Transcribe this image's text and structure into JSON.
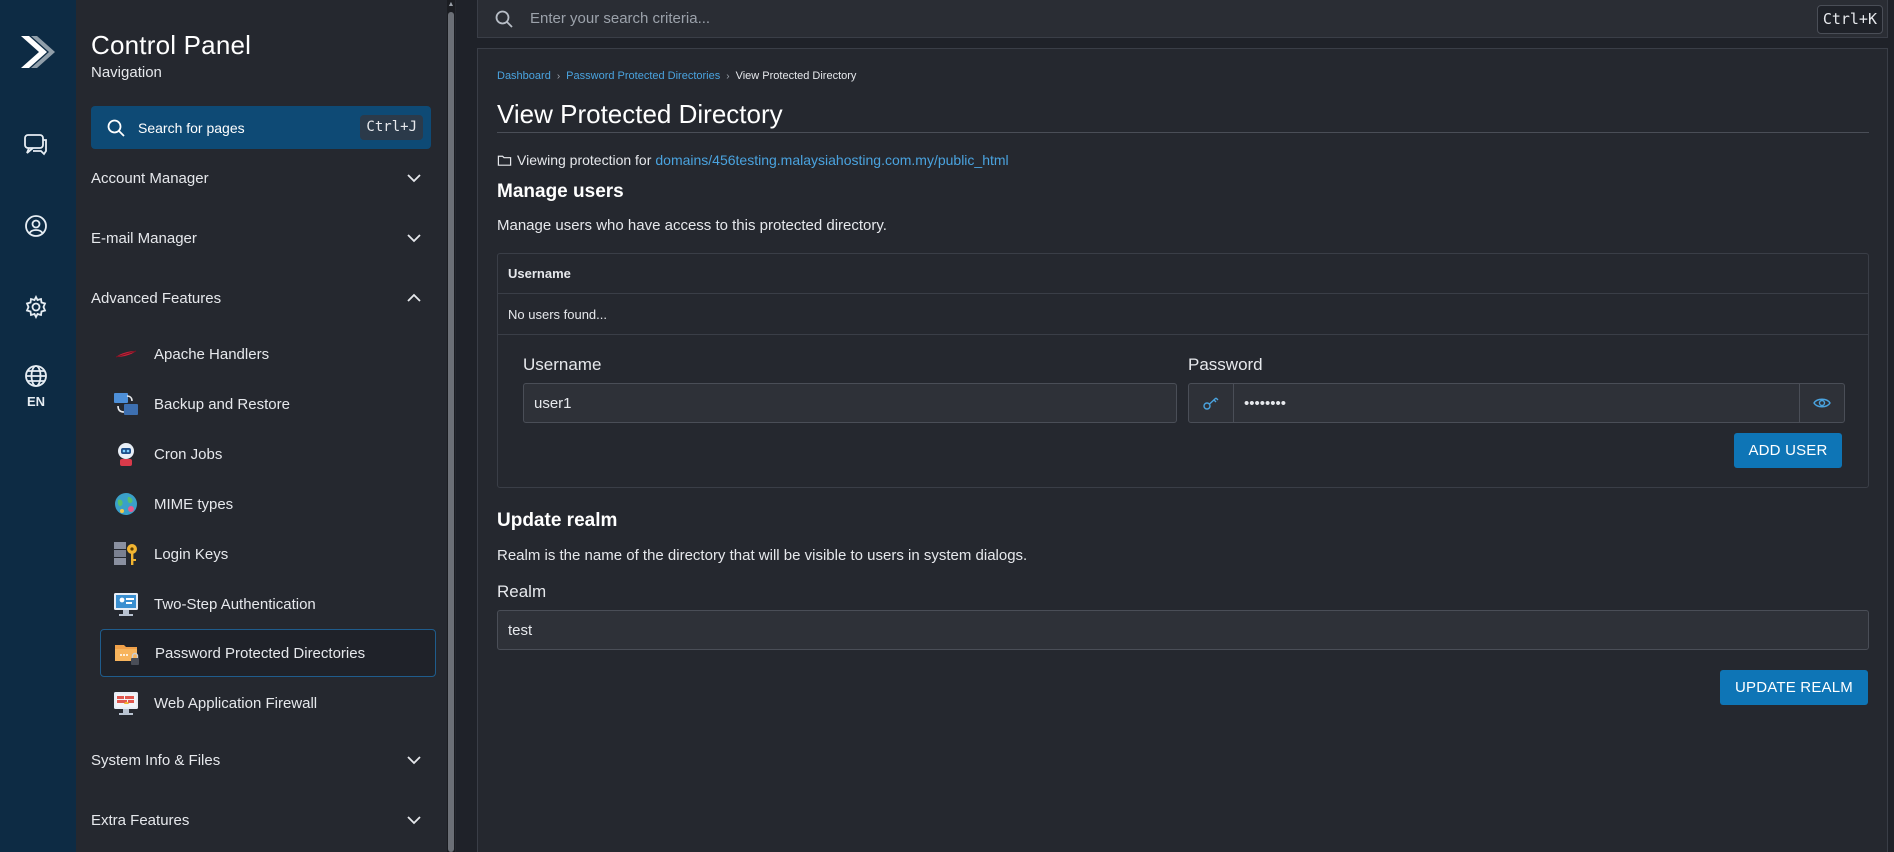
{
  "rail": {
    "logo": "forward-arrow-logo",
    "items": [
      {
        "name": "chat-icon"
      },
      {
        "name": "user-circle-icon"
      },
      {
        "name": "gear-icon"
      },
      {
        "name": "globe-icon"
      }
    ],
    "language": "EN"
  },
  "nav": {
    "title": "Control Panel",
    "subtitle": "Navigation",
    "search_label": "Search for pages",
    "search_shortcut": "Ctrl+J",
    "sections": {
      "account": "Account Manager",
      "email": "E-mail Manager",
      "advanced": "Advanced Features",
      "system": "System Info & Files",
      "extra": "Extra Features"
    },
    "items": [
      {
        "label": "Apache Handlers",
        "icon": "feather-icon"
      },
      {
        "label": "Backup and Restore",
        "icon": "backup-icon"
      },
      {
        "label": "Cron Jobs",
        "icon": "cron-robot-icon"
      },
      {
        "label": "MIME types",
        "icon": "mime-globe-icon"
      },
      {
        "label": "Login Keys",
        "icon": "key-icon"
      },
      {
        "label": "Two-Step Authentication",
        "icon": "monitor-icon"
      },
      {
        "label": "Password Protected Directories",
        "icon": "locked-folder-icon",
        "active": true
      },
      {
        "label": "Web Application Firewall",
        "icon": "firewall-icon"
      }
    ]
  },
  "topsearch": {
    "placeholder": "Enter your search criteria...",
    "shortcut": "Ctrl+K"
  },
  "main": {
    "breadcrumbs": [
      "Dashboard",
      "Password Protected Directories",
      "View Protected Directory"
    ],
    "title": "View Protected Directory",
    "viewing_prefix": "Viewing protection for",
    "viewing_path": "domains/456testing.malaysiahosting.com.my/public_html",
    "manage": {
      "heading": "Manage users",
      "description": "Manage users who have access to this protected directory.",
      "table_header": "Username",
      "empty_text": "No users found...",
      "username_label": "Username",
      "username_value": "user1",
      "password_label": "Password",
      "password_value": "••••••••",
      "add_button": "ADD USER"
    },
    "realm": {
      "heading": "Update realm",
      "description": "Realm is the name of the directory that will be visible to users in system dialogs.",
      "label": "Realm",
      "value": "test",
      "button": "UPDATE REALM"
    }
  },
  "colors": {
    "accent": "#0e75b6",
    "link": "#4aa3df",
    "rail": "#0d2b44",
    "search_active": "#0e4a75"
  }
}
